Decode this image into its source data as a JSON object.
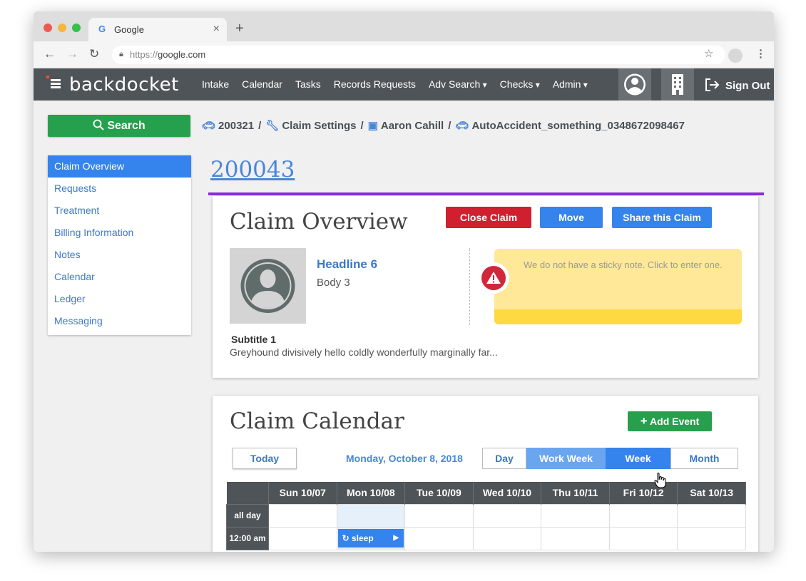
{
  "browser": {
    "tab_title": "Google",
    "tab_icon": "G",
    "new_tab": "+",
    "url_scheme": "https://",
    "url_host": "google.com"
  },
  "app": {
    "logo": "backdocket",
    "nav": [
      "Intake",
      "Calendar",
      "Tasks",
      "Records Requests",
      "Adv Search",
      "Checks",
      "Admin"
    ],
    "sign_out": "Sign Out"
  },
  "search_label": "Search",
  "breadcrumb": {
    "claim_id": "200321",
    "settings": "Claim Settings",
    "client": "Aaron Cahill",
    "file": "AutoAccident_something_0348672098467"
  },
  "sidebar": {
    "items": [
      {
        "label": "Claim Overview"
      },
      {
        "label": "Requests"
      },
      {
        "label": "Treatment"
      },
      {
        "label": "Billing Information"
      },
      {
        "label": "Notes"
      },
      {
        "label": "Calendar"
      },
      {
        "label": "Ledger"
      },
      {
        "label": "Messaging"
      }
    ]
  },
  "claim_number": "200043",
  "overview": {
    "title": "Claim Overview",
    "close_label": "Close Claim",
    "move_label": "Move",
    "share_label": "Share this Claim",
    "headline": "Headline 6",
    "body": "Body 3",
    "sticky_note": "We do not have a sticky note. Click to enter one.",
    "subtitle": "Subtitle 1",
    "subtext": "Greyhound divisively hello coldly wonderfully marginally far..."
  },
  "calendar": {
    "title": "Claim Calendar",
    "add_event": "Add Event",
    "today": "Today",
    "current_date": "Monday, October 8, 2018",
    "views": [
      "Day",
      "Work Week",
      "Week",
      "Month"
    ],
    "days": [
      "Sun 10/07",
      "Mon 10/08",
      "Tue 10/09",
      "Wed 10/10",
      "Thu 10/11",
      "Fri 10/12",
      "Sat 10/13"
    ],
    "rows": [
      "all day",
      "12:00 am"
    ],
    "event_label": "sleep"
  },
  "colors": {
    "primary": "#3583ec",
    "success": "#27a04d",
    "danger": "#d0273a",
    "header": "#4f5458",
    "accent_line": "#8a2be2",
    "sticky": "#ffe897"
  }
}
